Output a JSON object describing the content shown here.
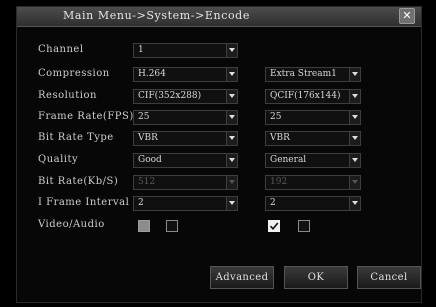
{
  "window": {
    "title": "Main Menu->System->Encode",
    "close_glyph": "✕"
  },
  "labels": {
    "channel": "Channel",
    "compression": "Compression",
    "resolution": "Resolution",
    "frame_rate": "Frame Rate(FPS)",
    "bit_rate_type": "Bit Rate Type",
    "quality": "Quality",
    "bit_rate": "Bit Rate(Kb/S)",
    "i_frame_interval": "I Frame Interval",
    "video_audio": "Video/Audio"
  },
  "main_stream": {
    "channel": "1",
    "compression": "H.264",
    "resolution": "CIF(352x288)",
    "frame_rate": "25",
    "bit_rate_type": "VBR",
    "quality": "Good",
    "bit_rate": "512",
    "i_frame_interval": "2",
    "video_enabled": false,
    "audio_enabled": false
  },
  "extra_stream": {
    "stream_type": "Extra Stream1",
    "resolution": "QCIF(176x144)",
    "frame_rate": "25",
    "bit_rate_type": "VBR",
    "quality": "General",
    "bit_rate": "192",
    "i_frame_interval": "2",
    "video_enabled": true,
    "audio_enabled": false
  },
  "buttons": {
    "advanced": "Advanced",
    "ok": "OK",
    "cancel": "Cancel"
  }
}
